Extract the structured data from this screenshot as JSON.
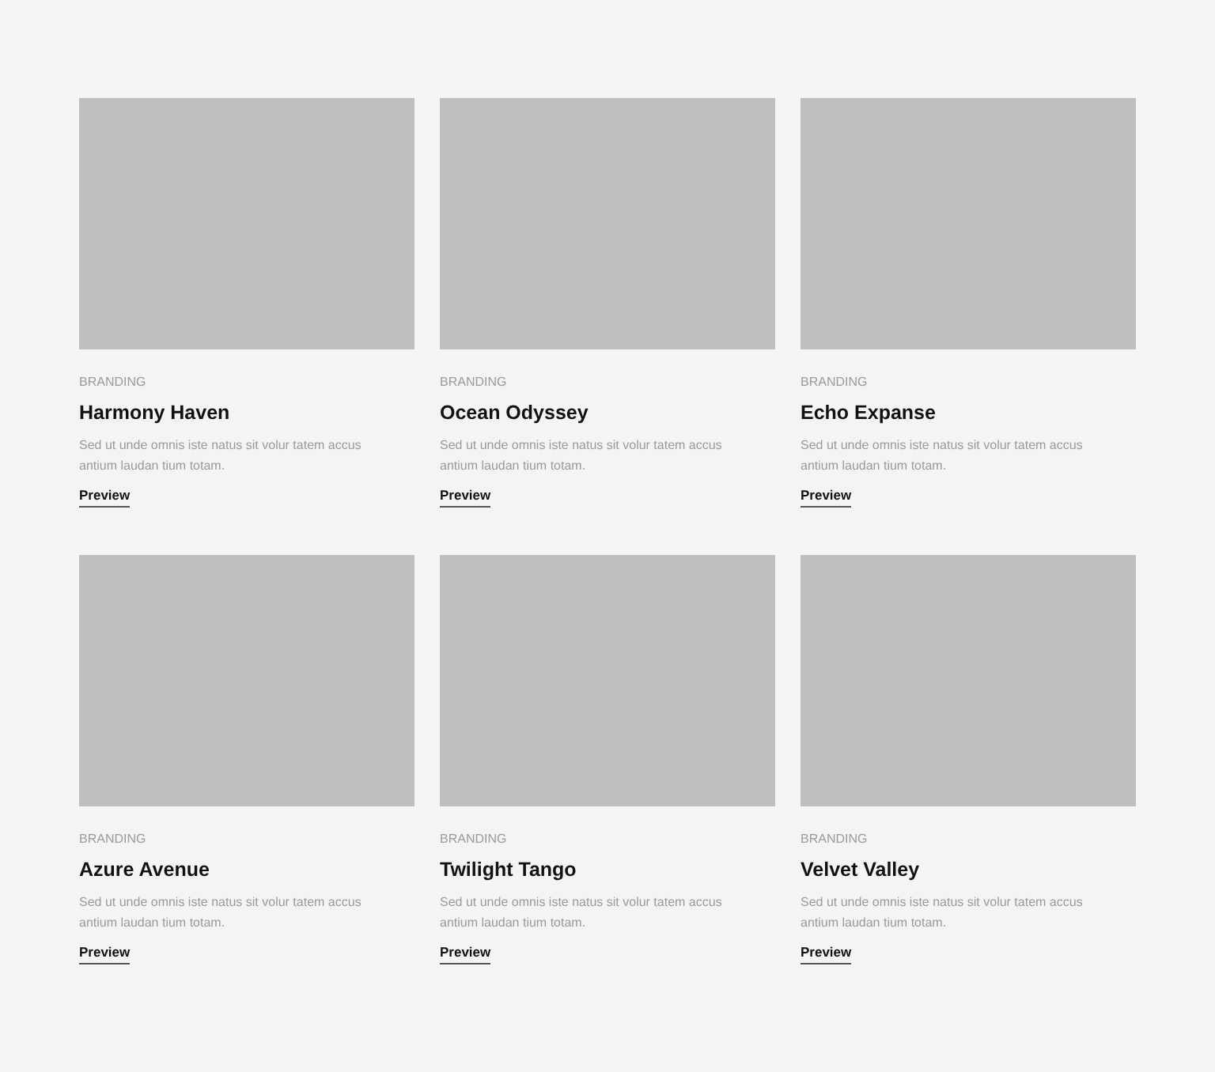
{
  "cards": [
    {
      "category": "BRANDING",
      "title": "Harmony Haven",
      "description": "Sed ut unde omnis iste natus sit volur tatem accus antium laudan tium totam.",
      "link": "Preview"
    },
    {
      "category": "BRANDING",
      "title": "Ocean Odyssey",
      "description": "Sed ut unde omnis iste natus sit volur tatem accus antium laudan tium totam.",
      "link": "Preview"
    },
    {
      "category": "BRANDING",
      "title": "Echo Expanse",
      "description": "Sed ut unde omnis iste natus sit volur tatem accus antium laudan tium totam.",
      "link": "Preview"
    },
    {
      "category": "BRANDING",
      "title": "Azure Avenue",
      "description": "Sed ut unde omnis iste natus sit volur tatem accus antium laudan tium totam.",
      "link": "Preview"
    },
    {
      "category": "BRANDING",
      "title": "Twilight Tango",
      "description": "Sed ut unde omnis iste natus sit volur tatem accus antium laudan tium totam.",
      "link": "Preview"
    },
    {
      "category": "BRANDING",
      "title": "Velvet Valley",
      "description": "Sed ut unde omnis iste natus sit volur tatem accus antium laudan tium totam.",
      "link": "Preview"
    }
  ]
}
